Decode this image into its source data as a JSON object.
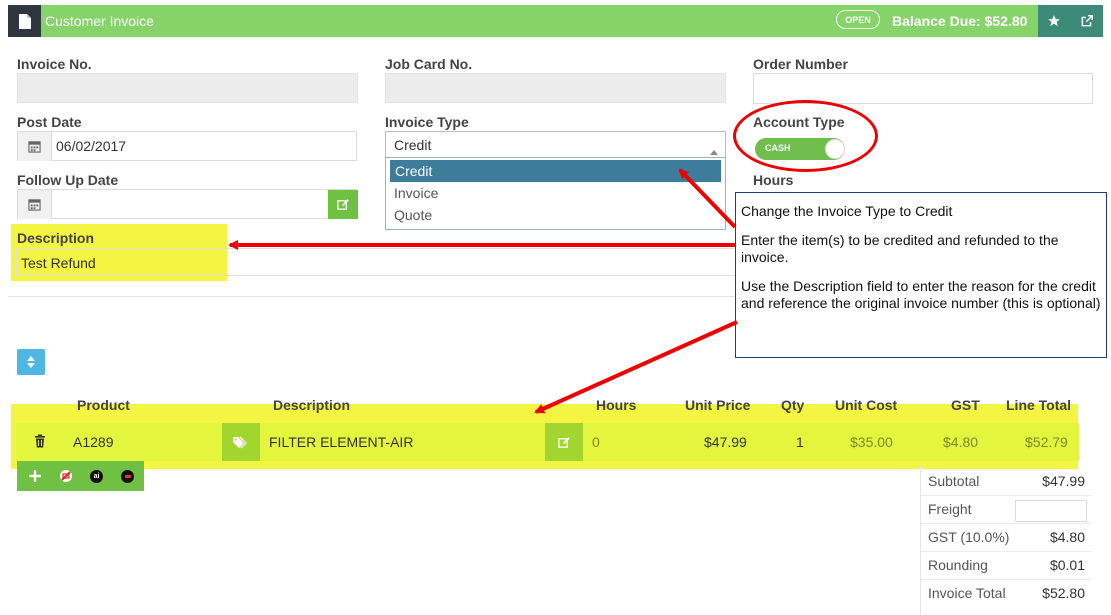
{
  "header": {
    "title": "Customer Invoice",
    "status": "OPEN",
    "balance": "Balance Due: $52.80",
    "colors": {
      "bar": "#86d36a",
      "icon_block": "#2f3640",
      "action_block": "#3c8a78"
    }
  },
  "form": {
    "invoice_no": {
      "label": "Invoice No.",
      "value": ""
    },
    "job_card_no": {
      "label": "Job Card No.",
      "value": ""
    },
    "order_number": {
      "label": "Order Number",
      "value": ""
    },
    "post_date": {
      "label": "Post Date",
      "value": "06/02/2017"
    },
    "invoice_type": {
      "label": "Invoice Type",
      "value": "Credit",
      "options": [
        "Credit",
        "Invoice",
        "Quote"
      ]
    },
    "account_type": {
      "label": "Account Type",
      "toggle": "CASH"
    },
    "follow_up_date": {
      "label": "Follow Up Date",
      "value": ""
    },
    "hours": {
      "label": "Hours"
    },
    "description": {
      "label": "Description",
      "value": "Test Refund"
    }
  },
  "tooltip": {
    "line1": "Change the Invoice Type to Credit",
    "line2": "Enter the item(s) to be credited and refunded to the invoice.",
    "line3": "Use the Description field to enter the reason for the credit and reference the original invoice number (this is optional)"
  },
  "table": {
    "headers": {
      "product": "Product",
      "description": "Description",
      "hours": "Hours",
      "unit_price": "Unit Price",
      "qty": "Qty",
      "unit_cost": "Unit Cost",
      "gst": "GST",
      "line_total": "Line Total"
    },
    "rows": [
      {
        "product": "A1289",
        "description": "FILTER ELEMENT-AIR",
        "hours": "0",
        "unit_price": "$47.99",
        "qty": "1",
        "unit_cost": "$35.00",
        "gst": "$4.80",
        "line_total": "$52.79"
      }
    ],
    "row_actions": [
      "plus-icon",
      "no-discount-icon",
      "ai-icon",
      "speed-icon"
    ]
  },
  "totals": {
    "subtotal": {
      "label": "Subtotal",
      "value": "$47.99"
    },
    "freight": {
      "label": "Freight",
      "value": ""
    },
    "gst": {
      "label": "GST (10.0%)",
      "value": "$4.80"
    },
    "rounding": {
      "label": "Rounding",
      "value": "$0.01"
    },
    "invoice_total": {
      "label": "Invoice Total",
      "value": "$52.80"
    }
  },
  "annotation_colors": {
    "highlight": "#f4f442",
    "arrow": "#ee0000"
  }
}
